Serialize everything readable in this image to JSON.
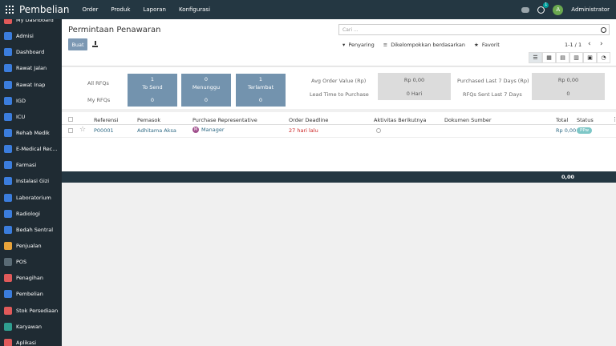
{
  "app": {
    "title": "Pembelian"
  },
  "topbar": {
    "menu": [
      "Order",
      "Produk",
      "Laporan",
      "Konfigurasi"
    ],
    "activity_count": "1",
    "user_initial": "A",
    "user_name": "Administrator"
  },
  "sidebar": {
    "items": [
      {
        "label": "My Dashboard",
        "icon": "dashboard-icon",
        "color": "#e05a5a"
      },
      {
        "label": "Admisi",
        "icon": "admission-icon",
        "color": "#3b7ddd"
      },
      {
        "label": "Dashboard",
        "icon": "dashboard-icon",
        "color": "#3b7ddd"
      },
      {
        "label": "Rawat Jalan",
        "icon": "outpatient-icon",
        "color": "#3b7ddd"
      },
      {
        "label": "Rawat Inap",
        "icon": "inpatient-icon",
        "color": "#3b7ddd"
      },
      {
        "label": "IGD",
        "icon": "emergency-icon",
        "color": "#3b7ddd"
      },
      {
        "label": "ICU",
        "icon": "icu-icon",
        "color": "#3b7ddd"
      },
      {
        "label": "Rehab Medik",
        "icon": "rehab-icon",
        "color": "#3b7ddd"
      },
      {
        "label": "E-Medical Rec...",
        "icon": "medical-record-icon",
        "color": "#3b7ddd"
      },
      {
        "label": "Farmasi",
        "icon": "pharmacy-icon",
        "color": "#3b7ddd"
      },
      {
        "label": "Instalasi Gizi",
        "icon": "nutrition-icon",
        "color": "#3b7ddd"
      },
      {
        "label": "Laboratorium",
        "icon": "lab-icon",
        "color": "#3b7ddd"
      },
      {
        "label": "Radiologi",
        "icon": "radiology-icon",
        "color": "#3b7ddd"
      },
      {
        "label": "Bedah Sentral",
        "icon": "surgery-icon",
        "color": "#3b7ddd"
      },
      {
        "label": "Penjualan",
        "icon": "sales-icon",
        "color": "#e8a33a"
      },
      {
        "label": "POS",
        "icon": "pos-icon",
        "color": "#5a6b75"
      },
      {
        "label": "Penagihan",
        "icon": "invoice-icon",
        "color": "#e05a5a"
      },
      {
        "label": "Pembelian",
        "icon": "purchase-icon",
        "color": "#3b7ddd"
      },
      {
        "label": "Stok Persediaan",
        "icon": "inventory-icon",
        "color": "#e05a5a"
      },
      {
        "label": "Karyawan",
        "icon": "employees-icon",
        "color": "#2f9e8f"
      },
      {
        "label": "Aplikasi",
        "icon": "apps-icon",
        "color": "#e05a5a"
      }
    ]
  },
  "control_panel": {
    "breadcrumb": "Permintaan Penawaran",
    "search_placeholder": "Cari ...",
    "create_label": "Buat",
    "filters_label": "Penyaring",
    "group_label": "Dikelompokkan berdasarkan",
    "favorites_label": "Favorit",
    "pager": "1-1 / 1"
  },
  "dashboard": {
    "all_rfqs_label": "All RFQs",
    "my_rfqs_label": "My RFQs",
    "tiles": [
      {
        "top": "1",
        "label": "To Send",
        "bottom": "0"
      },
      {
        "top": "0",
        "label": "Menunggu",
        "bottom": "0"
      },
      {
        "top": "1",
        "label": "Terlambat",
        "bottom": "0"
      }
    ],
    "stats": {
      "avg_order_label": "Avg Order Value (Rp)",
      "avg_order_value": "Rp 0,00",
      "lead_time_label": "Lead Time to Purchase",
      "lead_time_value": "0  Hari",
      "purchased_label": "Purchased Last 7 Days (Rp)",
      "purchased_value": "Rp 0,00",
      "rfqs_sent_label": "RFQs Sent Last 7 Days",
      "rfqs_sent_value": "0"
    }
  },
  "table": {
    "headers": {
      "ref": "Referensi",
      "vendor": "Pemasok",
      "rep": "Purchase Representative",
      "deadline": "Order Deadline",
      "activity": "Aktivitas Berikutnya",
      "source": "Dokumen Sumber",
      "total": "Total",
      "status": "Status"
    },
    "rows": [
      {
        "ref": "P00001",
        "vendor": "Adhitama Aksa",
        "rep_initial": "M",
        "rep": "Manager",
        "deadline": "27 hari lalu",
        "total": "Rp 0,00",
        "status": "PPw"
      }
    ],
    "footer_total": "0,00"
  }
}
